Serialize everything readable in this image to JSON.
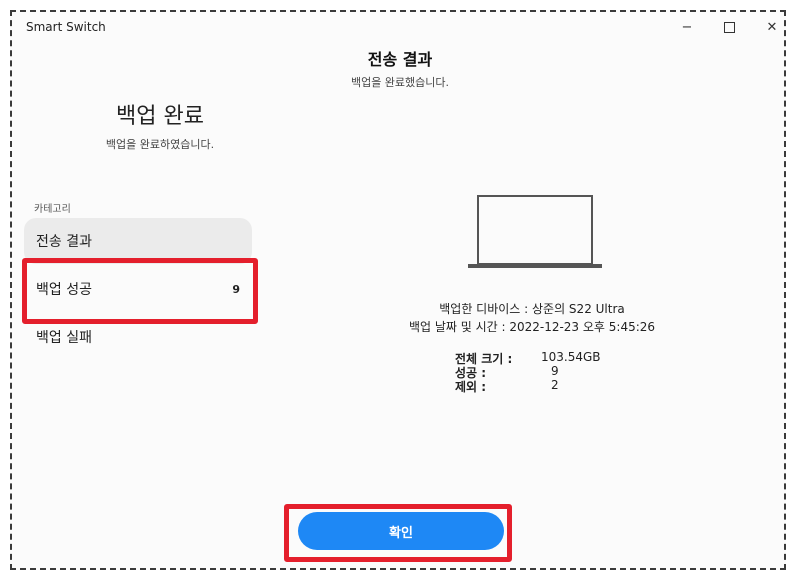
{
  "window": {
    "title": "Smart Switch",
    "minimize": "−",
    "close": "✕"
  },
  "main": {
    "title": "전송 결과",
    "subtitle": "백업을 완료했습니다."
  },
  "left": {
    "title": "백업 완료",
    "subtitle": "백업을 완료하였습니다.",
    "category_label": "카테고리",
    "items": [
      {
        "label": "전송 결과",
        "count": ""
      },
      {
        "label": "백업 성공",
        "count": "9"
      },
      {
        "label": "백업 실패",
        "count": ""
      }
    ]
  },
  "device": {
    "name_line": "백업한 디바이스 : 상준의 S22 Ultra",
    "date_line": "백업 날짜 및 시간 : 2022-12-23 오후 5:45:26"
  },
  "stats": [
    {
      "label": "전체 크기 :",
      "value": "103.54GB"
    },
    {
      "label": "성공 :",
      "value": "9"
    },
    {
      "label": "제외 :",
      "value": "2"
    }
  ],
  "footer": {
    "confirm_label": "확인"
  },
  "colors": {
    "accent": "#1e88f5",
    "highlight": "#e41f2c"
  }
}
